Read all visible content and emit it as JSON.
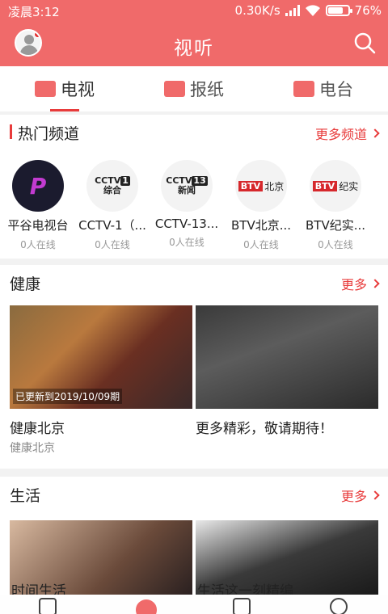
{
  "status_bar": {
    "time": "凌晨3:12",
    "speed": "0.30K/s",
    "battery_percent": "76%",
    "battery_level": 0.76
  },
  "header": {
    "title": "视听"
  },
  "tabs": [
    {
      "label": "电视",
      "active": true
    },
    {
      "label": "报纸",
      "active": false
    },
    {
      "label": "电台",
      "active": false
    }
  ],
  "hot_channels": {
    "title": "热门频道",
    "more_label": "更多频道",
    "items": [
      {
        "name": "平谷电视台",
        "online": "0人在线",
        "logo_text": "P"
      },
      {
        "name": "CCTV-1（...",
        "online": "0人在线",
        "logo_main": "CCTV",
        "logo_num": "1",
        "logo_sub": "综合"
      },
      {
        "name": "CCTV-13...",
        "online": "0人在线",
        "logo_main": "CCTV",
        "logo_num": "13",
        "logo_sub": "新闻"
      },
      {
        "name": "BTV北京...",
        "online": "0人在线",
        "logo_main": "BTV",
        "logo_sub": "北京"
      },
      {
        "name": "BTV纪实...",
        "online": "0人在线",
        "logo_main": "BTV",
        "logo_sub": "纪实"
      }
    ]
  },
  "health": {
    "title": "健康",
    "more_label": "更多",
    "cards": [
      {
        "title": "健康北京",
        "subtitle": "健康北京",
        "badge": "已更新到2019/10/09期"
      },
      {
        "title": "更多精彩，敬请期待！"
      }
    ]
  },
  "life": {
    "title": "生活",
    "more_label": "更多",
    "cards": [
      {
        "title": "时间生活"
      },
      {
        "title": "生活这一刻精编"
      }
    ]
  },
  "colors": {
    "brand": "#f06a6a",
    "accent": "#e83b3b"
  }
}
